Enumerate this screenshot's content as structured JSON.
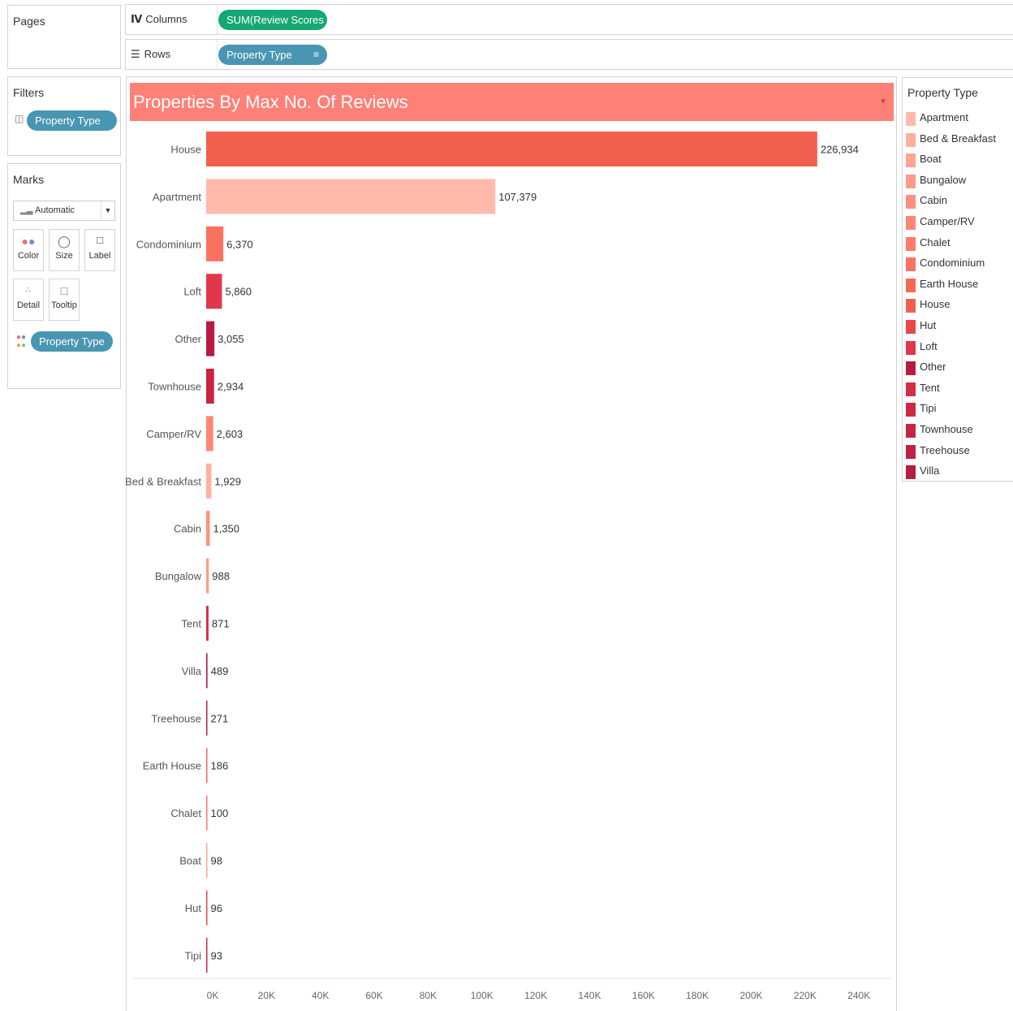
{
  "shelves": {
    "pages": {
      "label": "Pages"
    },
    "columns": {
      "label": "Columns",
      "pill": "SUM(Review Scores .."
    },
    "rows": {
      "label": "Rows",
      "pill": "Property Type"
    }
  },
  "filters": {
    "title": "Filters",
    "pill": "Property Type"
  },
  "marks": {
    "title": "Marks",
    "mark_type": "Automatic",
    "buttons": [
      "Color",
      "Size",
      "Label",
      "Detail",
      "Tooltip"
    ],
    "color_pill": "Property Type"
  },
  "legend": {
    "title": "Property Type",
    "items": [
      {
        "label": "Apartment",
        "color": "#ffbaab"
      },
      {
        "label": "Bed & Breakfast",
        "color": "#ffb0a0"
      },
      {
        "label": "Boat",
        "color": "#ffa594"
      },
      {
        "label": "Bungalow",
        "color": "#ff9b89"
      },
      {
        "label": "Cabin",
        "color": "#ff907d"
      },
      {
        "label": "Camper/RV",
        "color": "#ff8672"
      },
      {
        "label": "Chalet",
        "color": "#ff7b67"
      },
      {
        "label": "Condominium",
        "color": "#fb7160"
      },
      {
        "label": "Earth House",
        "color": "#f66856"
      },
      {
        "label": "House",
        "color": "#f0604f"
      },
      {
        "label": "Hut",
        "color": "#e94848"
      },
      {
        "label": "Loft",
        "color": "#e0374a"
      },
      {
        "label": "Other",
        "color": "#b81b40"
      },
      {
        "label": "Tent",
        "color": "#d52d45"
      },
      {
        "label": "Tipi",
        "color": "#cf2844"
      },
      {
        "label": "Townhouse",
        "color": "#c72441"
      },
      {
        "label": "Treehouse",
        "color": "#bf2040"
      },
      {
        "label": "Villa",
        "color": "#b51c3d"
      }
    ]
  },
  "chart_data": {
    "type": "bar",
    "orientation": "horizontal",
    "title": "Properties By Max No. Of Reviews",
    "categories": [
      "House",
      "Apartment",
      "Condominium",
      "Loft",
      "Other",
      "Townhouse",
      "Camper/RV",
      "Bed & Breakfast",
      "Cabin",
      "Bungalow",
      "Tent",
      "Villa",
      "Treehouse",
      "Earth House",
      "Chalet",
      "Boat",
      "Hut",
      "Tipi"
    ],
    "values": [
      226934,
      107379,
      6370,
      5860,
      3055,
      2934,
      2603,
      1929,
      1350,
      988,
      871,
      489,
      271,
      186,
      100,
      98,
      96,
      93
    ],
    "value_labels": [
      "226,934",
      "107,379",
      "6,370",
      "5,860",
      "3,055",
      "2,934",
      "2,603",
      "1,929",
      "1,350",
      "988",
      "871",
      "489",
      "271",
      "186",
      "100",
      "98",
      "96",
      "93"
    ],
    "bar_colors": [
      "#f0604f",
      "#ffbaab",
      "#fb7160",
      "#e0374a",
      "#b81b40",
      "#c72441",
      "#ff8672",
      "#ffb0a0",
      "#ff907d",
      "#ff9b89",
      "#d52d45",
      "#b51c3d",
      "#bf2040",
      "#f66856",
      "#ff7b67",
      "#ffa594",
      "#e94848",
      "#cf2844"
    ],
    "xticks": [
      0,
      20000,
      40000,
      60000,
      80000,
      100000,
      120000,
      140000,
      160000,
      180000,
      200000,
      220000,
      240000
    ],
    "xtick_labels": [
      "0K",
      "20K",
      "40K",
      "60K",
      "80K",
      "100K",
      "120K",
      "140K",
      "160K",
      "180K",
      "200K",
      "220K",
      "240K"
    ],
    "xlim": [
      0,
      252000
    ],
    "grid": false,
    "legend": "right"
  }
}
